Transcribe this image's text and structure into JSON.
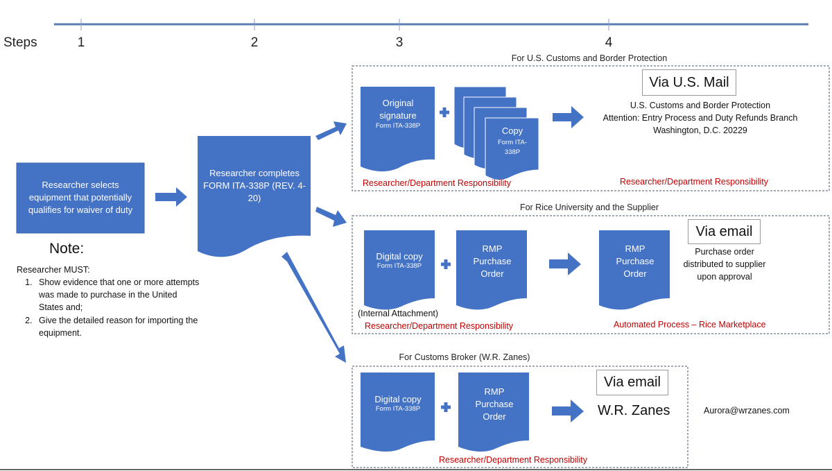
{
  "colors": {
    "shape_fill": "#4472c4",
    "timeline": "#5b7db1",
    "responsibility_text": "#c00000",
    "dashed_border": "#44546a"
  },
  "timeline": {
    "label": "Steps",
    "steps": [
      "1",
      "2",
      "3",
      "4"
    ]
  },
  "step1": {
    "box_text": "Researcher selects equipment that potentially qualifies for waiver of duty"
  },
  "step2": {
    "doc_text": "Researcher completes FORM ITA-338P (REV. 4-20)"
  },
  "note": {
    "title": "Note:",
    "intro": "Researcher MUST:",
    "items": [
      "Show evidence that one or more attempts was made to purchase in the United States and;",
      "Give the detailed reason for importing the equipment."
    ]
  },
  "groups": {
    "cbp": {
      "title": "For U.S. Customs and Border Protection",
      "doc1": {
        "title": "Original signature",
        "sub": "Form ITA-338P"
      },
      "copies": {
        "title": "Copy",
        "sub": "Form ITA-338P"
      },
      "via": "Via U.S. Mail",
      "address": [
        "U.S. Customs and Border Protection",
        "Attention: Entry Process and Duty Refunds Branch",
        "Washington, D.C. 20229"
      ],
      "resp_left": "Researcher/Department Responsibility",
      "resp_right": "Researcher/Department Responsibility"
    },
    "rice": {
      "title": "For Rice University and the Supplier",
      "doc1": {
        "title": "Digital copy",
        "sub": "Form ITA-338P"
      },
      "doc1_caption": "(Internal Attachment)",
      "doc2": {
        "title": "RMP Purchase Order"
      },
      "doc3": {
        "title": "RMP Purchase Order"
      },
      "via": "Via email",
      "description": [
        "Purchase order",
        "distributed to supplier",
        "upon approval"
      ],
      "resp_left": "Researcher/Department Responsibility",
      "resp_right": "Automated Process – Rice Marketplace"
    },
    "broker": {
      "title": "For Customs Broker (W.R. Zanes)",
      "doc1": {
        "title": "Digital copy",
        "sub": "Form ITA-338P"
      },
      "doc2": {
        "title": "RMP Purchase Order"
      },
      "via": "Via email",
      "recipient": "W.R. Zanes",
      "email": "Aurora@wrzanes.com",
      "resp": "Researcher/Department Responsibility"
    }
  }
}
